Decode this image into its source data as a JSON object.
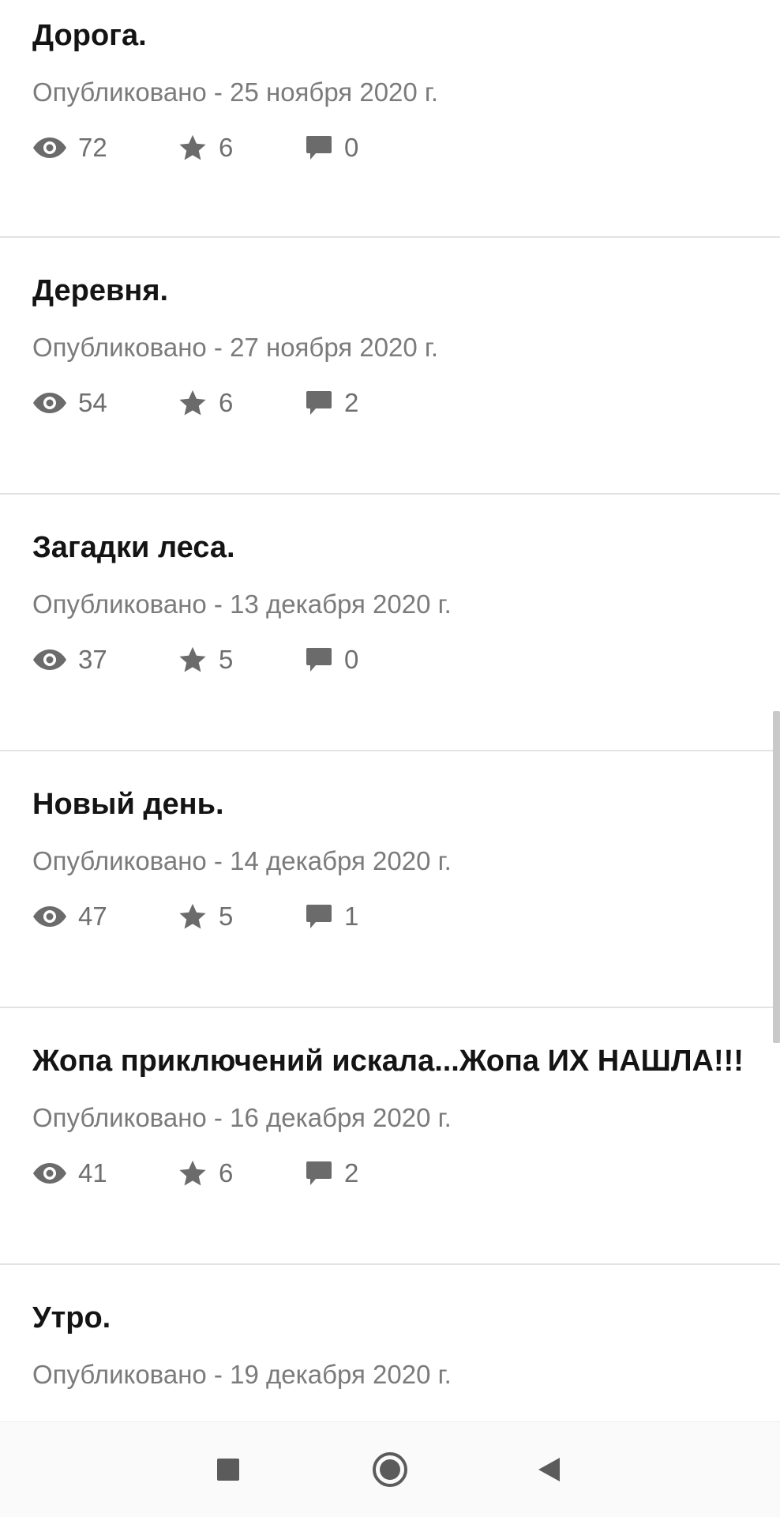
{
  "posts": [
    {
      "title": "Дорога.",
      "date": "Опубликовано - 25 ноября 2020 г.",
      "views": "72",
      "stars": "6",
      "comments": "0"
    },
    {
      "title": "Деревня.",
      "date": "Опубликовано - 27 ноября 2020 г.",
      "views": "54",
      "stars": "6",
      "comments": "2"
    },
    {
      "title": "Загадки леса.",
      "date": "Опубликовано - 13 декабря 2020 г.",
      "views": "37",
      "stars": "5",
      "comments": "0"
    },
    {
      "title": "Новый день.",
      "date": "Опубликовано - 14 декабря 2020 г.",
      "views": "47",
      "stars": "5",
      "comments": "1"
    },
    {
      "title": "Жопа приключений искала...Жопа ИХ НАШЛА!!!",
      "date": "Опубликовано - 16 декабря 2020 г.",
      "views": "41",
      "stars": "6",
      "comments": "2"
    },
    {
      "title": "Утро.",
      "date": "Опубликовано - 19 декабря 2020 г.",
      "views": "",
      "stars": "",
      "comments": ""
    }
  ],
  "icons": {
    "views": "eye-icon",
    "stars": "star-icon",
    "comments": "comment-icon",
    "nav_recent": "square-icon",
    "nav_home": "circle-icon",
    "nav_back": "triangle-back-icon"
  },
  "colors": {
    "icon": "#6b6b6b",
    "title": "#141414",
    "meta": "#7b7b7b",
    "divider": "#e3e3e3"
  }
}
